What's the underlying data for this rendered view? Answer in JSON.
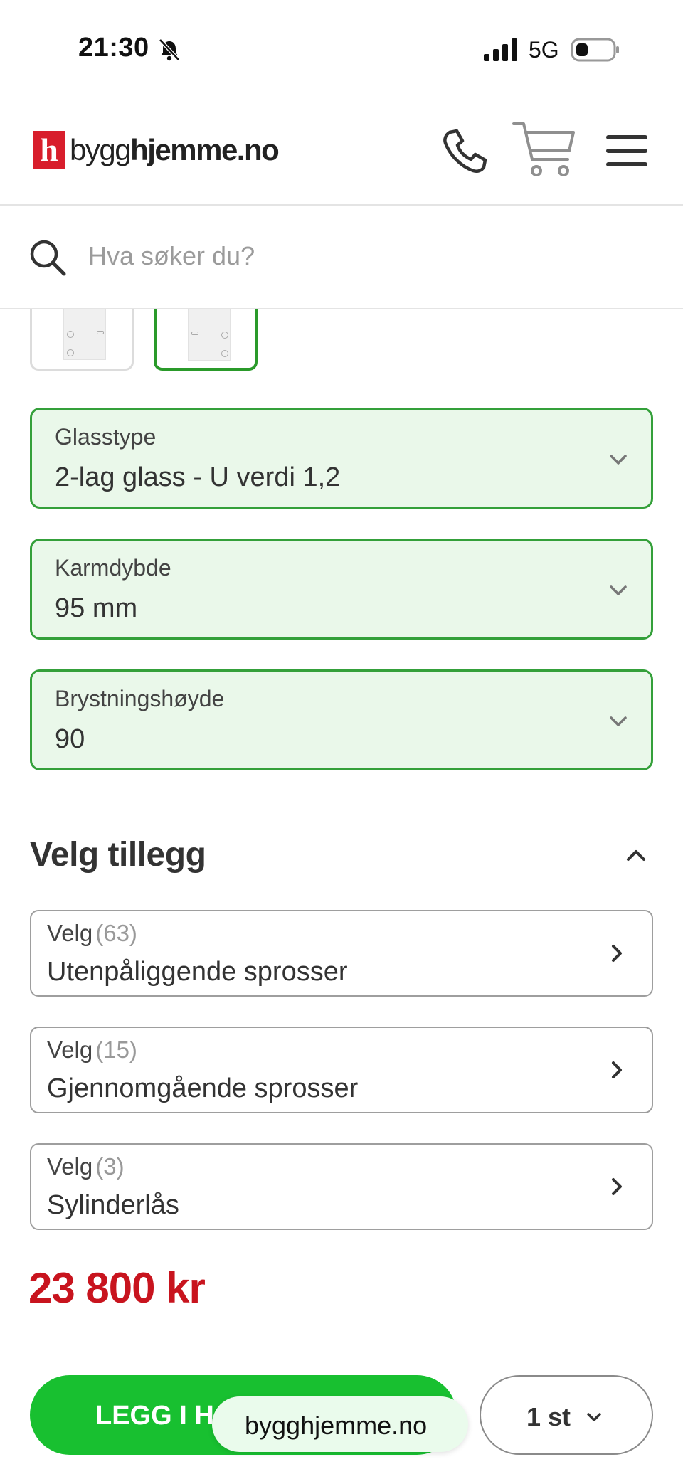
{
  "status_bar": {
    "time": "21:30",
    "network": "5G"
  },
  "header": {
    "logo": {
      "mark": "h",
      "text_prefix": "bygg",
      "text_suffix": "hjemme.no"
    }
  },
  "search": {
    "placeholder": "Hva søker du?"
  },
  "options": [
    {
      "label": "Glasstype",
      "value": "2-lag glass - U verdi 1,2"
    },
    {
      "label": "Karmdybde",
      "value": "95 mm"
    },
    {
      "label": "Brystningshøyde",
      "value": "90"
    }
  ],
  "addons": {
    "title": "Velg tillegg",
    "items": [
      {
        "prefix": "Velg",
        "count": "(63)",
        "name": "Utenpåliggende sprosser"
      },
      {
        "prefix": "Velg",
        "count": "(15)",
        "name": "Gjennomgående sprosser"
      },
      {
        "prefix": "Velg",
        "count": "(3)",
        "name": "Sylinderlås"
      }
    ]
  },
  "price": "23 800 kr",
  "actions": {
    "add_to_cart": "LEGG I H",
    "quantity": "1 st"
  },
  "url_bar": {
    "domain": "bygghjemme.no"
  },
  "colors": {
    "accent_green": "#18c030",
    "border_green": "#34a03a",
    "price_red": "#c8141e",
    "logo_red": "#d81e2c"
  }
}
